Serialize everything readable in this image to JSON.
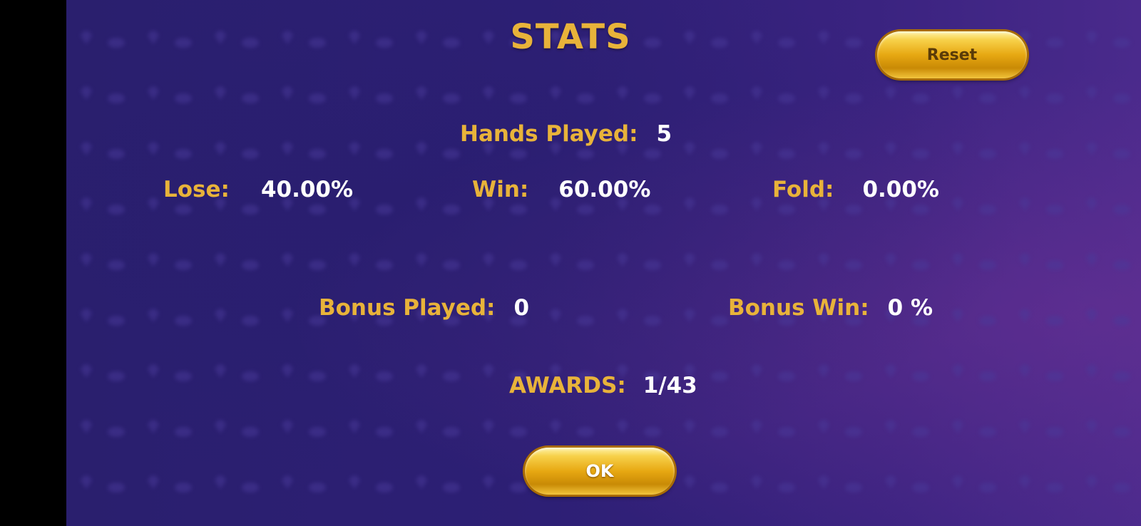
{
  "title": "STATS",
  "reset_label": "Reset",
  "ok_label": "OK",
  "hands_played": {
    "label": "Hands Played:",
    "value": "5"
  },
  "lose": {
    "label": "Lose:",
    "value": "40.00%"
  },
  "win": {
    "label": "Win:",
    "value": "60.00%"
  },
  "fold": {
    "label": "Fold:",
    "value": "0.00%"
  },
  "bonus_played": {
    "label": "Bonus Played:",
    "value": "0"
  },
  "bonus_win": {
    "label": "Bonus Win:",
    "value": "0 %"
  },
  "awards": {
    "label": "AWARDS:",
    "value": "1/43"
  },
  "colors": {
    "label_gold": "#e8b33a",
    "value_white": "#ffffff",
    "background_purple": "#2d1f75"
  }
}
